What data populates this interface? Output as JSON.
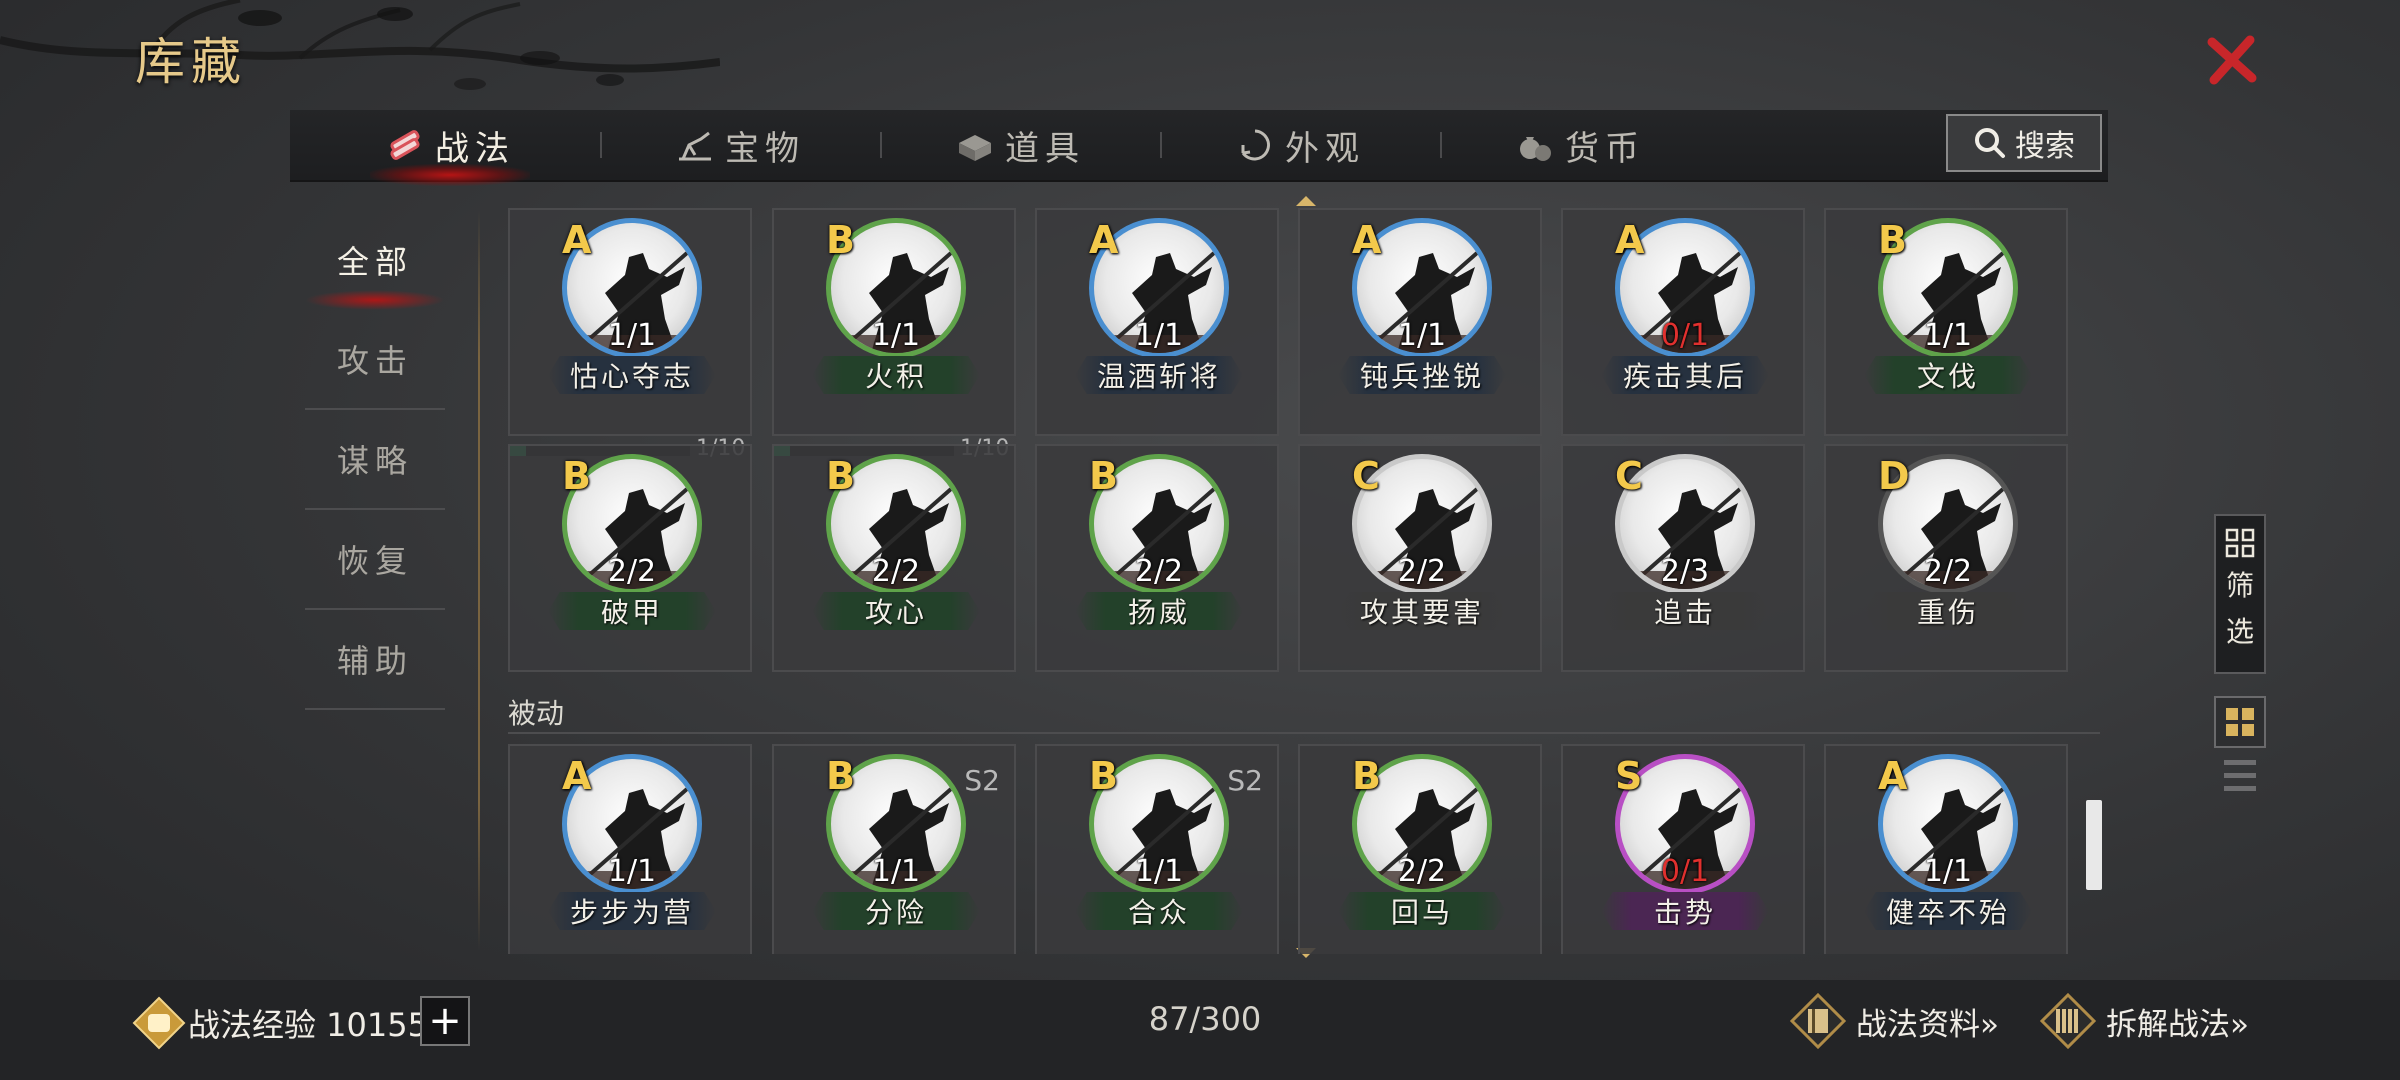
{
  "header": {
    "title": "库藏"
  },
  "tabs": [
    {
      "label": "战法",
      "icon": "scroll-bundle-icon",
      "active": true
    },
    {
      "label": "宝物",
      "icon": "treasure-icon",
      "active": false
    },
    {
      "label": "道具",
      "icon": "chest-icon",
      "active": false
    },
    {
      "label": "外观",
      "icon": "swirl-icon",
      "active": false
    },
    {
      "label": "货币",
      "icon": "money-bag-icon",
      "active": false
    }
  ],
  "search": {
    "label": "搜索"
  },
  "categories": [
    {
      "label": "全部",
      "active": true
    },
    {
      "label": "攻击"
    },
    {
      "label": "谋略"
    },
    {
      "label": "恢复"
    },
    {
      "label": "辅助"
    }
  ],
  "grade_colors": {
    "S": "#b84fc4",
    "A": "#4a8fd0",
    "B": "#5fa34a",
    "C": "#c9c9c9",
    "D": "#555555"
  },
  "plate_colors": {
    "S": "#4b2653",
    "A": "#26313f",
    "B": "#23412a",
    "C": "#3a3a3a",
    "D": "#3a3a3a"
  },
  "active_cards": [
    {
      "grade": "A",
      "count": "1/1",
      "name": "怙心夺志",
      "progress": {
        "value": 1,
        "max": 10,
        "label": "1/10"
      }
    },
    {
      "grade": "B",
      "count": "1/1",
      "name": "火积",
      "progress": {
        "value": 1,
        "max": 10,
        "label": "1/10"
      }
    },
    {
      "grade": "A",
      "count": "1/1",
      "name": "温酒斩将"
    },
    {
      "grade": "A",
      "count": "1/1",
      "name": "钝兵挫锐"
    },
    {
      "grade": "A",
      "count": "0/1",
      "name": "疾击其后",
      "count_red": true
    },
    {
      "grade": "B",
      "count": "1/1",
      "name": "文伐"
    },
    {
      "grade": "B",
      "count": "2/2",
      "name": "破甲"
    },
    {
      "grade": "B",
      "count": "2/2",
      "name": "攻心"
    },
    {
      "grade": "B",
      "count": "2/2",
      "name": "扬威"
    },
    {
      "grade": "C",
      "count": "2/2",
      "name": "攻其要害"
    },
    {
      "grade": "C",
      "count": "2/3",
      "name": "追击"
    },
    {
      "grade": "D",
      "count": "2/2",
      "name": "重伤"
    }
  ],
  "passive_section": {
    "title": "被动"
  },
  "passive_cards": [
    {
      "grade": "A",
      "count": "1/1",
      "name": "步步为营"
    },
    {
      "grade": "B",
      "count": "1/1",
      "name": "分险",
      "season": "S2"
    },
    {
      "grade": "B",
      "count": "1/1",
      "name": "合众",
      "season": "S2"
    },
    {
      "grade": "B",
      "count": "2/2",
      "name": "回马"
    },
    {
      "grade": "S",
      "count": "0/1",
      "name": "击势",
      "count_red": true
    },
    {
      "grade": "A",
      "count": "1/1",
      "name": "健卒不殆"
    }
  ],
  "side_controls": {
    "filter_label_1": "筛",
    "filter_label_2": "选"
  },
  "footer": {
    "exp_label": "战法经验 10155",
    "capacity": "87/300",
    "info_link": "战法资料»",
    "disassemble_link": "拆解战法»"
  }
}
